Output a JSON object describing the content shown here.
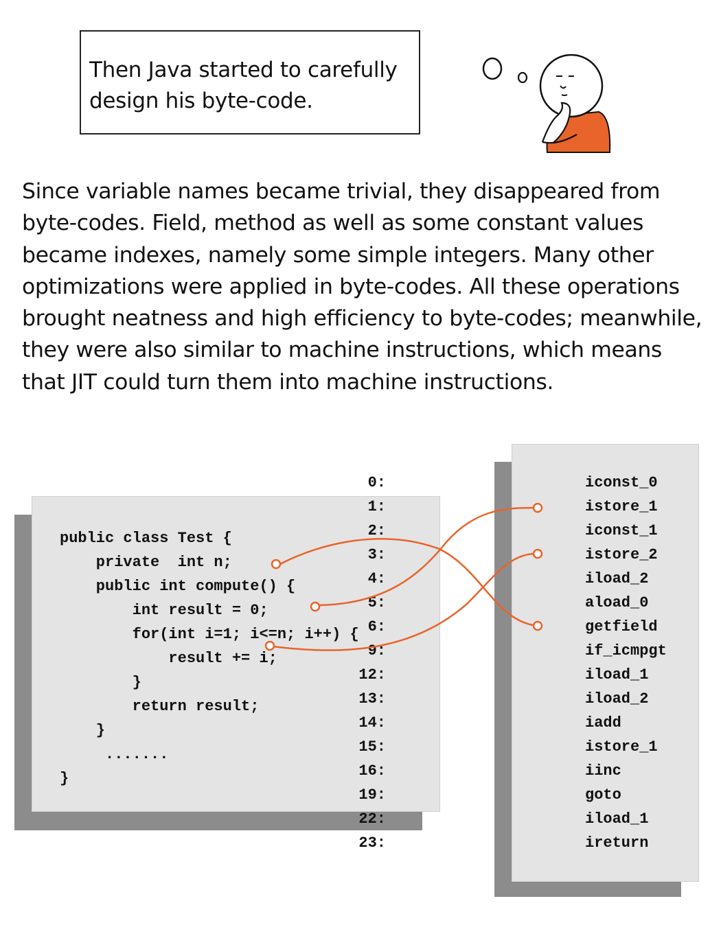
{
  "caption": {
    "text": "Then Java started to carefully design his byte-code."
  },
  "paragraph": {
    "text": "Since variable names became trivial, they disappeared from byte-codes. Field, method as well as some constant values became indexes, namely some simple integers. Many other optimizations were applied in byte-codes. All these operations brought neatness and high efficiency to byte-codes; meanwhile, they were also similar to machine instructions, which means that JIT could turn them into machine instructions."
  },
  "source_code": {
    "lines": [
      "public class Test {",
      "    private  int n;",
      "    public int compute() {",
      "        int result = 0;",
      "        for(int i=1; i<=n; i++) {",
      "            result += i;",
      "        }",
      "        return result;",
      "    }",
      "     .......",
      "}"
    ]
  },
  "bytecode": {
    "rows": [
      {
        "offset": "0:",
        "instr": "iconst_0"
      },
      {
        "offset": "1:",
        "instr": "istore_1"
      },
      {
        "offset": "2:",
        "instr": "iconst_1"
      },
      {
        "offset": "3:",
        "instr": "istore_2"
      },
      {
        "offset": "4:",
        "instr": "iload_2"
      },
      {
        "offset": "5:",
        "instr": "aload_0"
      },
      {
        "offset": "6:",
        "instr": "getfield"
      },
      {
        "offset": "9:",
        "instr": "if_icmpgt"
      },
      {
        "offset": "12:",
        "instr": "iload_1"
      },
      {
        "offset": "13:",
        "instr": "iload_2"
      },
      {
        "offset": "14:",
        "instr": "iadd"
      },
      {
        "offset": "15:",
        "instr": "istore_1"
      },
      {
        "offset": "16:",
        "instr": "iinc"
      },
      {
        "offset": "19:",
        "instr": "goto"
      },
      {
        "offset": "22:",
        "instr": "iload_1"
      },
      {
        "offset": "23:",
        "instr": "ireturn"
      }
    ]
  },
  "colors": {
    "accent": "#e8642a",
    "panel": "#e4e4e4",
    "shadow": "#8c8c8c"
  }
}
